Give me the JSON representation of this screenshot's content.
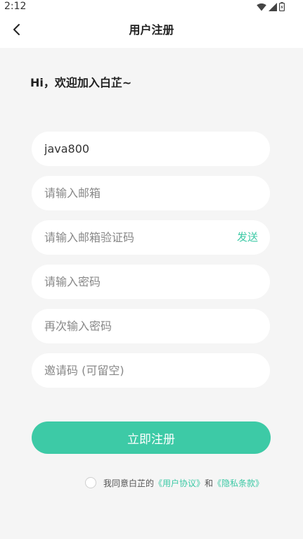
{
  "status_bar": {
    "time": "2:12",
    "icons": [
      "wifi-icon",
      "signal-icon",
      "battery-icon"
    ]
  },
  "nav": {
    "title": "用户注册",
    "back_icon": "chevron-left-icon"
  },
  "welcome_text": "Hi，欢迎加入白芷~",
  "form": {
    "username": {
      "value": "java800",
      "placeholder": ""
    },
    "email": {
      "value": "",
      "placeholder": "请输入邮箱"
    },
    "email_code": {
      "value": "",
      "placeholder": "请输入邮箱验证码",
      "send_label": "发送"
    },
    "password": {
      "value": "",
      "placeholder": "请输入密码"
    },
    "password_confirm": {
      "value": "",
      "placeholder": "再次输入密码"
    },
    "invite_code": {
      "value": "",
      "placeholder": "邀请码 (可留空)"
    }
  },
  "register_button": "立即注册",
  "agreement": {
    "prefix": "我同意白芷的",
    "user_agreement": "《用户协议》",
    "and": "和",
    "privacy_policy": "《隐私条款》"
  },
  "colors": {
    "accent": "#3dcaa6",
    "background": "#f5f5f5",
    "field_background": "#ffffff"
  }
}
